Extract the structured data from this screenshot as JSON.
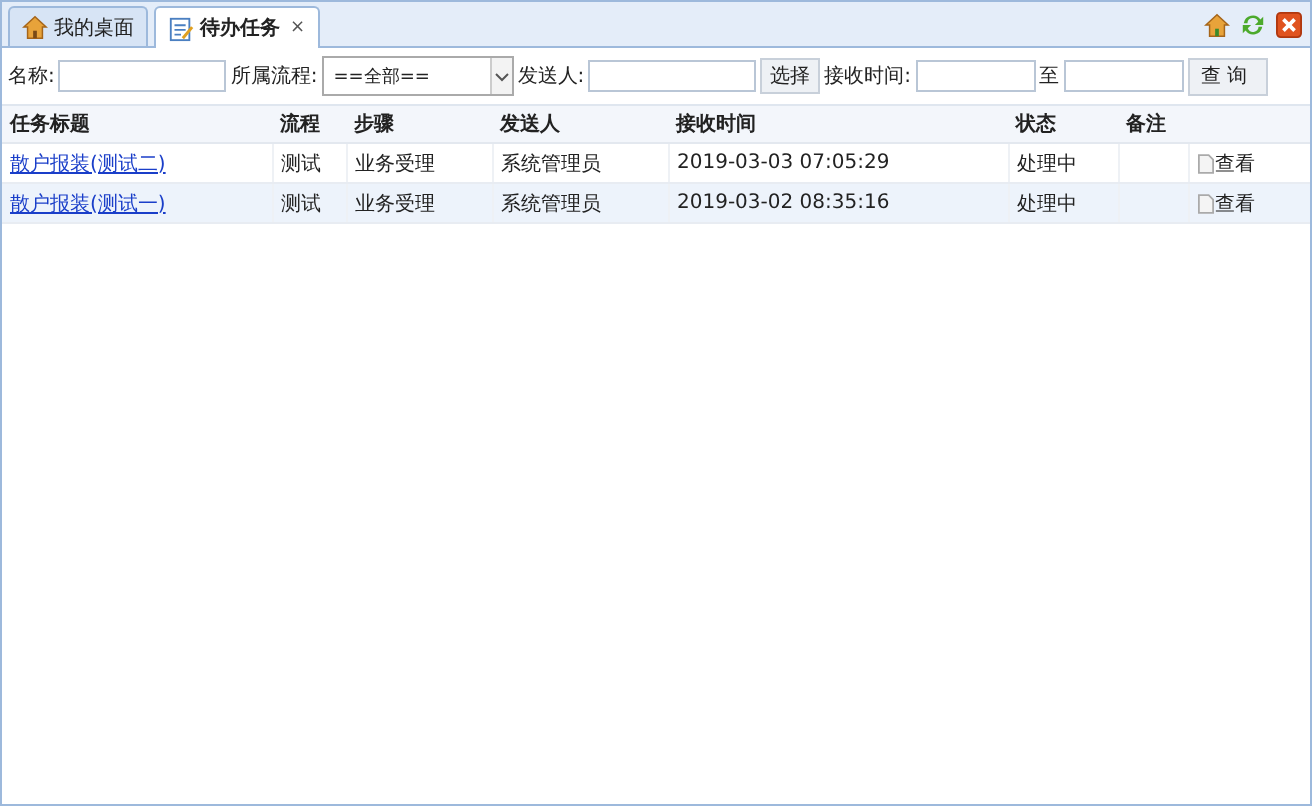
{
  "tabs": [
    {
      "label": "我的桌面",
      "selected": false,
      "kind": "home"
    },
    {
      "label": "待办任务",
      "selected": true,
      "kind": "notepad",
      "close": "×"
    }
  ],
  "filters": {
    "name_label": "名称:",
    "process_label": "所属流程:",
    "process_value": "==全部==",
    "sender_label": "发送人:",
    "choose_button": "选择",
    "time_label": "接收时间:",
    "to_label": "至",
    "query_button": "查询"
  },
  "table": {
    "columns": [
      "任务标题",
      "流程",
      "步骤",
      "发送人",
      "接收时间",
      "状态",
      "备注"
    ],
    "rows": [
      {
        "title": "散户报装(测试二)",
        "process": "测试",
        "step": "业务受理",
        "sender": "系统管理员",
        "time": "2019-03-03 07:05:29",
        "status": "处理中",
        "action": "查看"
      },
      {
        "title": "散户报装(测试一)",
        "process": "测试",
        "step": "业务受理",
        "sender": "系统管理员",
        "time": "2019-03-02 08:35:16",
        "status": "处理中",
        "action": "查看"
      }
    ]
  }
}
